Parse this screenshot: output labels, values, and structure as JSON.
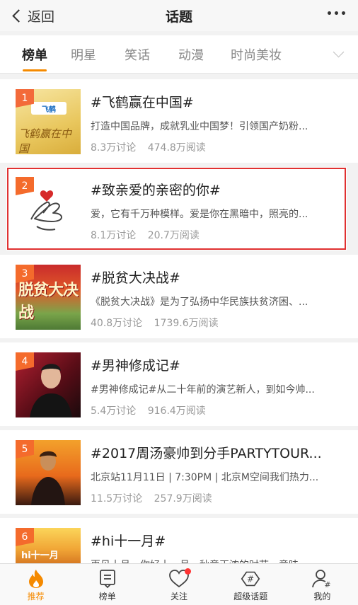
{
  "header": {
    "back_label": "返回",
    "title": "话题"
  },
  "tabs": [
    {
      "label": "榜单",
      "active": true
    },
    {
      "label": "明星"
    },
    {
      "label": "笑话"
    },
    {
      "label": "动漫"
    },
    {
      "label": "时尚美妆"
    }
  ],
  "topics": [
    {
      "rank": "1",
      "title": "#飞鹤赢在中国#",
      "desc": "打造中国品牌，成就乳业中国梦！引领国产奶粉...",
      "discuss": "8.3万讨论",
      "reads": "474.8万阅读",
      "thumb_logo": "飞鹤",
      "thumb_text": "飞鹤赢在中国"
    },
    {
      "rank": "2",
      "title": "#致亲爱的亲密的你#",
      "desc": "爱，它有千万种模样。爱是你在黑暗中，照亮的...",
      "discuss": "8.1万讨论",
      "reads": "20.7万阅读"
    },
    {
      "rank": "3",
      "title": "#脱贫大决战#",
      "desc": "《脱贫大决战》是为了弘扬中华民族扶贫济困、...",
      "discuss": "40.8万讨论",
      "reads": "1739.6万阅读",
      "thumb_text": "脱贫大决战"
    },
    {
      "rank": "4",
      "title": "#男神修成记#",
      "desc": "#男神修成记#从二十年前的演艺新人，到如今帅...",
      "discuss": "5.4万讨论",
      "reads": "916.4万阅读"
    },
    {
      "rank": "5",
      "title": "#2017周汤豪帅到分手PARTYTOUR...",
      "desc": "北京站11月11日 | 7:30PM | 北京M空间我们热力...",
      "discuss": "11.5万讨论",
      "reads": "257.9万阅读"
    },
    {
      "rank": "6",
      "title": "#hi十一月#",
      "desc": "再见十月，你好十一月，秋意正浓的时节，意味...",
      "discuss": "",
      "reads": "",
      "thumb_text": "hi十一月"
    }
  ],
  "bottom_nav": [
    {
      "label": "推荐",
      "icon": "flame-icon",
      "active": true
    },
    {
      "label": "榜单",
      "icon": "list-icon"
    },
    {
      "label": "关注",
      "icon": "heart-icon",
      "badge": true
    },
    {
      "label": "超级话题",
      "icon": "super-topic-icon"
    },
    {
      "label": "我的",
      "icon": "profile-icon"
    }
  ],
  "colors": {
    "accent": "#f58a00",
    "rank_badge": "#f46b2c",
    "highlight_border": "#e03131"
  }
}
